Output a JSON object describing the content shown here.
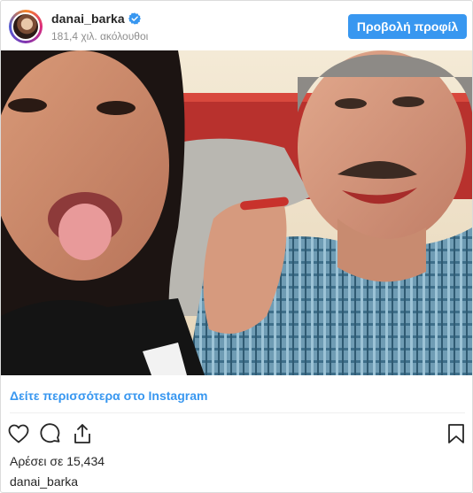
{
  "post": {
    "username": "danai_barka",
    "verified": true,
    "followers_text": "181,4 χιλ. ακόλουθοι",
    "view_profile_label": "Προβολή προφίλ",
    "more_link": "Δείτε περισσότερα στο Instagram",
    "likes_text": "Αρέσει σε 15,434",
    "caption_username": "danai_barka"
  },
  "icons": {
    "verified": "verified-badge-icon",
    "like": "heart-icon",
    "comment": "comment-icon",
    "share": "share-icon",
    "save": "bookmark-icon"
  },
  "colors": {
    "accent": "#3897f0",
    "text": "#262626",
    "muted": "#8e8e8e",
    "border": "#dbdbdb"
  }
}
